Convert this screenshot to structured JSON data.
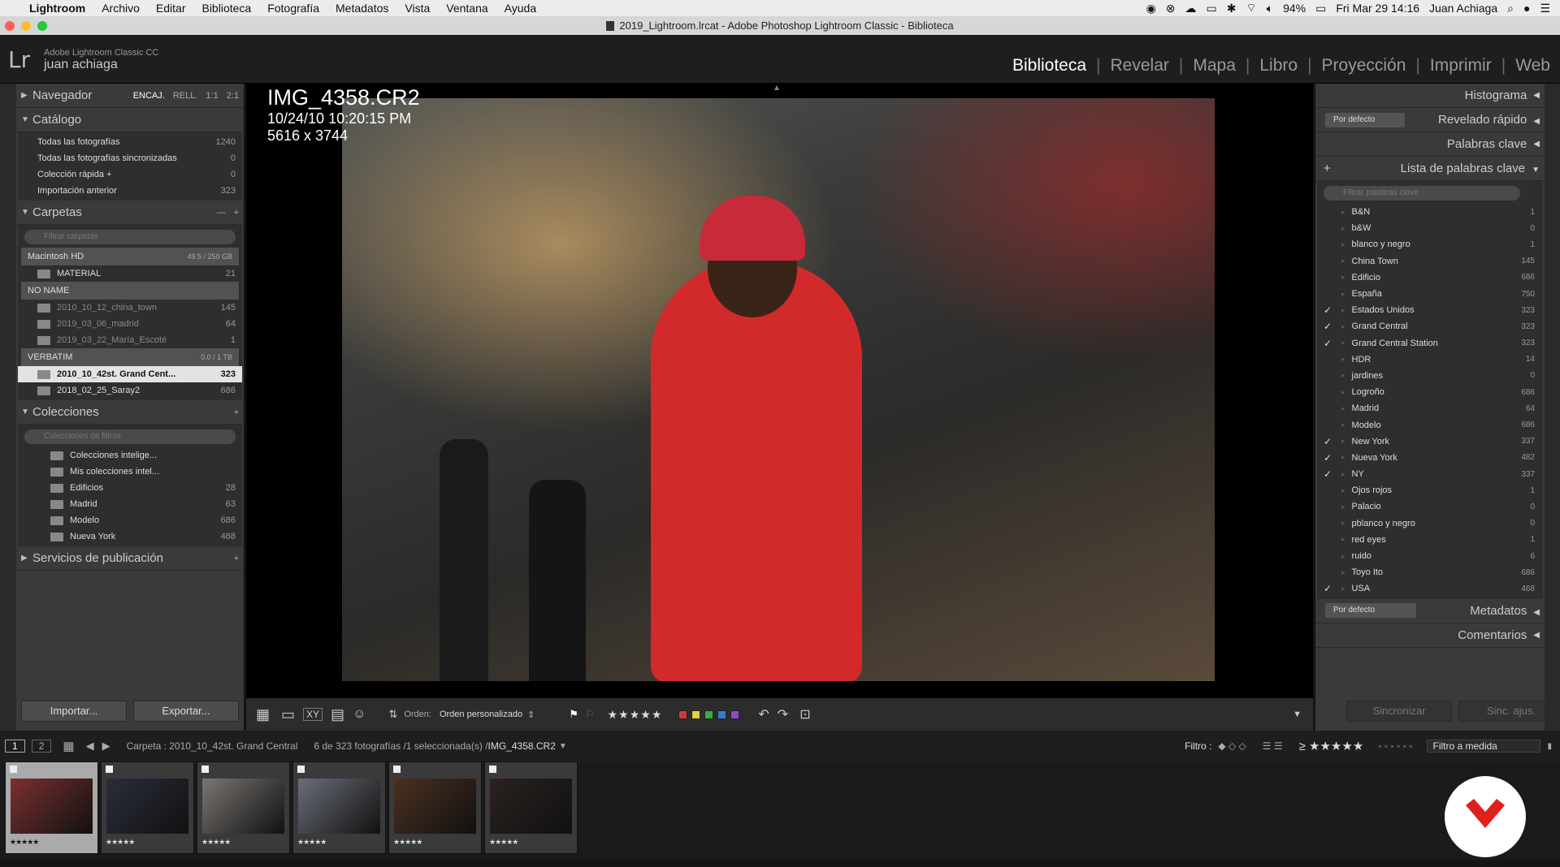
{
  "mac": {
    "app": "Lightroom",
    "menus": [
      "Archivo",
      "Editar",
      "Biblioteca",
      "Fotografía",
      "Metadatos",
      "Vista",
      "Ventana",
      "Ayuda"
    ],
    "battery": "94%",
    "datetime": "Fri Mar 29  14:16",
    "user": "Juan Achiaga"
  },
  "window_title": "2019_Lightroom.lrcat - Adobe Photoshop Lightroom Classic - Biblioteca",
  "identity": {
    "product": "Adobe Lightroom Classic CC",
    "user": "juan achiaga",
    "logo": "Lr"
  },
  "modules": [
    {
      "label": "Biblioteca",
      "active": true
    },
    {
      "label": "Revelar"
    },
    {
      "label": "Mapa"
    },
    {
      "label": "Libro"
    },
    {
      "label": "Proyección"
    },
    {
      "label": "Imprimir"
    },
    {
      "label": "Web"
    }
  ],
  "navigator": {
    "title": "Navegador",
    "opts": [
      "ENCAJ.",
      "RELL.",
      "1:1",
      "2:1"
    ]
  },
  "catalog": {
    "title": "Catálogo",
    "items": [
      {
        "label": "Todas las fotografías",
        "count": "1240"
      },
      {
        "label": "Todas las fotografías sincronizadas",
        "count": "0"
      },
      {
        "label": "Colección rápida +",
        "count": "0"
      },
      {
        "label": "Importación anterior",
        "count": "323"
      }
    ]
  },
  "folders": {
    "title": "Carpetas",
    "filter_placeholder": "Filtrar carpetas",
    "volumes": [
      {
        "name": "Macintosh HD",
        "size": "49.5 / 250 GB",
        "items": [
          {
            "label": "MATERIAL",
            "count": "21"
          }
        ]
      },
      {
        "name": "NO NAME",
        "size": "",
        "items": [
          {
            "label": "2010_10_12_china_town",
            "count": "145"
          },
          {
            "label": "2019_03_06_madrid",
            "count": "64"
          },
          {
            "label": "2019_03_22_María_Escoté",
            "count": "1"
          }
        ]
      },
      {
        "name": "VERBATIM",
        "size": "0.0 / 1 TB",
        "items": [
          {
            "label": "2010_10_42st. Grand Cent...",
            "count": "323",
            "selected": true
          },
          {
            "label": "2018_02_25_Saray2",
            "count": "686"
          }
        ]
      }
    ]
  },
  "collections": {
    "title": "Colecciones",
    "filter_placeholder": "Colecciones de filtros",
    "items": [
      {
        "label": "Colecciones intelige...",
        "count": ""
      },
      {
        "label": "Mis colecciones intel...",
        "count": ""
      },
      {
        "label": "Edificios",
        "count": "28"
      },
      {
        "label": "Madrid",
        "count": "63"
      },
      {
        "label": "Modelo",
        "count": "686"
      },
      {
        "label": "Nueva York",
        "count": "468"
      }
    ]
  },
  "publish": {
    "title": "Servicios de publicación"
  },
  "buttons": {
    "import": "Importar...",
    "export": "Exportar...",
    "sync": "Sincronizar",
    "sync_settings": "Sinc. ajus."
  },
  "photo": {
    "filename": "IMG_4358.CR2",
    "datetime": "10/24/10 10:20:15 PM",
    "dimensions": "5616 x 3744"
  },
  "toolbar": {
    "sort_label": "Orden:",
    "sort_value": "Orden personalizado",
    "colors": [
      "#d23a3a",
      "#e0d23a",
      "#3aae3a",
      "#3a7ad2",
      "#8a4ad2"
    ]
  },
  "right": {
    "histogram": "Histograma",
    "quick_dev": "Revelado rápido",
    "preset": "Por defecto",
    "keywords": "Palabras clave",
    "keyword_list": "Lista de palabras clave",
    "kw_filter": "Filtrar palabras clave",
    "metadata": "Metadatos",
    "comments": "Comentarios",
    "kw_items": [
      {
        "label": "B&N",
        "count": "1",
        "checked": false
      },
      {
        "label": "b&W",
        "count": "0",
        "checked": false
      },
      {
        "label": "blanco y negro",
        "count": "1",
        "checked": false
      },
      {
        "label": "China Town",
        "count": "145",
        "checked": false
      },
      {
        "label": "Edificio",
        "count": "686",
        "checked": false
      },
      {
        "label": "España",
        "count": "750",
        "checked": false
      },
      {
        "label": "Estados Unidos",
        "count": "323",
        "checked": true
      },
      {
        "label": "Grand Central",
        "count": "323",
        "checked": true
      },
      {
        "label": "Grand Central Station",
        "count": "323",
        "checked": true
      },
      {
        "label": "HDR",
        "count": "14",
        "checked": false
      },
      {
        "label": "jardines",
        "count": "0",
        "checked": false
      },
      {
        "label": "Logroño",
        "count": "686",
        "checked": false
      },
      {
        "label": "Madrid",
        "count": "64",
        "checked": false
      },
      {
        "label": "Modelo",
        "count": "686",
        "checked": false
      },
      {
        "label": "New York",
        "count": "337",
        "checked": true
      },
      {
        "label": "Nueva York",
        "count": "482",
        "checked": true
      },
      {
        "label": "NY",
        "count": "337",
        "checked": true
      },
      {
        "label": "Ojos rojos",
        "count": "1",
        "checked": false
      },
      {
        "label": "Palacio",
        "count": "0",
        "checked": false
      },
      {
        "label": "pblanco y negro",
        "count": "0",
        "checked": false
      },
      {
        "label": "red eyes",
        "count": "1",
        "checked": false
      },
      {
        "label": "ruido",
        "count": "6",
        "checked": false
      },
      {
        "label": "Toyo Ito",
        "count": "686",
        "checked": false
      },
      {
        "label": "USA",
        "count": "468",
        "checked": true
      }
    ]
  },
  "filmstrip": {
    "screens": [
      "1",
      "2"
    ],
    "path": "Carpeta : 2010_10_42st. Grand Central",
    "count_text": "6 de 323 fotografías /1 seleccionada(s) /",
    "selected_file": "IMG_4358.CR2",
    "filter_label": "Filtro :",
    "filter_mode": "Filtro a medida",
    "stars": "★★★★★",
    "thumbs": [
      {
        "stars": "★★★★★",
        "selected": true,
        "color": "#7a3030"
      },
      {
        "stars": "★★★★★",
        "color": "#2a2e3a"
      },
      {
        "stars": "★★★★★",
        "color": "#7a7672"
      },
      {
        "stars": "★★★★★",
        "color": "#6a6e78"
      },
      {
        "stars": "★★★★★",
        "color": "#4a3020"
      },
      {
        "stars": "★★★★★",
        "color": "#2a2220"
      }
    ]
  }
}
